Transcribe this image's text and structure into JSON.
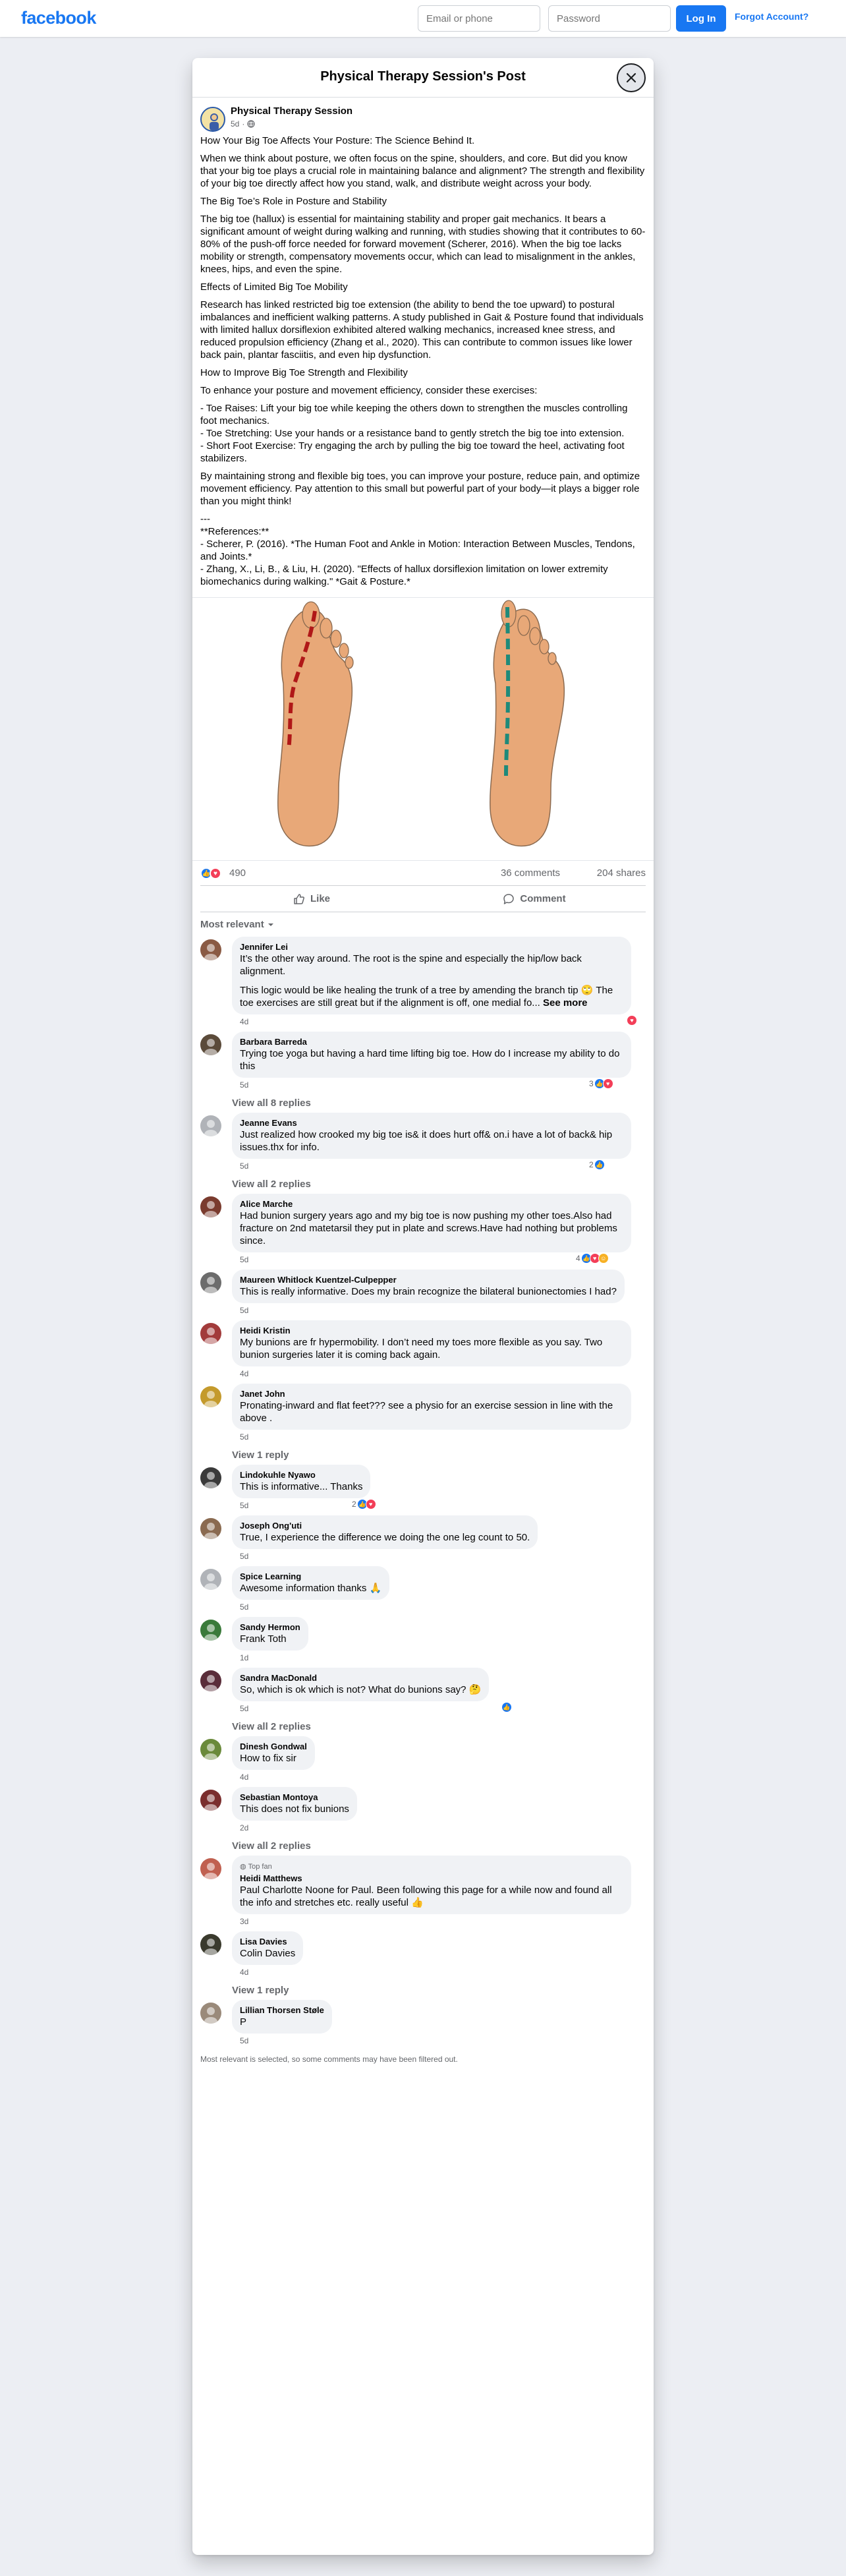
{
  "header": {
    "logo": "facebook",
    "email_placeholder": "Email or phone",
    "password_placeholder": "Password",
    "login_label": "Log In",
    "forgot_label": "Forgot Account?"
  },
  "dialog": {
    "title": "Physical Therapy Session's Post"
  },
  "post": {
    "page_name": "Physical Therapy Session",
    "time": "5d",
    "paragraphs": [
      "How Your Big Toe Affects Your Posture: The Science Behind It.",
      "When we think about posture, we often focus on the spine, shoulders, and core. But did you know that your big toe plays a crucial role in maintaining balance and alignment? The strength and flexibility of your big toe directly affect how you stand, walk, and distribute weight across your body.",
      "The Big Toe’s Role in Posture and Stability",
      "The big toe (hallux) is essential for maintaining stability and proper gait mechanics. It bears a significant amount of weight during walking and running, with studies showing that it contributes to 60-80% of the push-off force needed for forward movement (Scherer, 2016). When the big toe lacks mobility or strength, compensatory movements occur, which can lead to misalignment in the ankles, knees, hips, and even the spine.",
      "Effects of Limited Big Toe Mobility",
      "Research has linked restricted big toe extension (the ability to bend the toe upward) to postural imbalances and inefficient walking patterns. A study published in Gait & Posture found that individuals with limited hallux dorsiflexion exhibited altered walking mechanics, increased knee stress, and reduced propulsion efficiency (Zhang et al., 2020). This can contribute to common issues like lower back pain, plantar fasciitis, and even hip dysfunction.",
      "How to Improve Big Toe Strength and Flexibility",
      "To enhance your posture and movement efficiency, consider these exercises:",
      "- Toe Raises: Lift your big toe while keeping the others down to strengthen the muscles controlling foot mechanics.\n- Toe Stretching: Use your hands or a resistance band to gently stretch the big toe into extension.\n- Short Foot Exercise: Try engaging the arch by pulling the big toe toward the heel, activating foot stabilizers.",
      "By maintaining strong and flexible big toes, you can improve your posture, reduce pain, and optimize movement efficiency. Pay attention to this small but powerful part of your body—it plays a bigger role than you might think!",
      "---\n**References:**\n- Scherer, P. (2016). *The Human Foot and Ankle in Motion: Interaction Between Muscles, Tendons, and Joints.*\n- Zhang, X., Li, B., & Liu, H. (2020). \"Effects of hallux dorsiflexion limitation on lower extremity biomechanics during walking.\" *Gait & Posture.*"
    ],
    "reactions_count": "490",
    "comments_count": "36 comments",
    "shares_count": "204 shares",
    "like_label": "Like",
    "comment_label": "Comment",
    "sort_label": "Most relevant"
  },
  "comments": [
    {
      "author": "Jennifer Lei",
      "text": "It’s the other way around. The root is the spine and especially the hip/low back alignment.",
      "text2": "This logic would be like healing the trunk of a tree by amending the branch tip 🙄 The toe exercises are still great but if the alignment is off, one medial fo...",
      "see_more": "See more",
      "time": "4d",
      "reactions": "",
      "replies": ""
    },
    {
      "author": "Barbara Barreda",
      "text": "Trying toe yoga but having a hard time lifting big toe. How do I increase my ability to do this",
      "time": "5d",
      "reactions": "3",
      "replies": "View all 8 replies"
    },
    {
      "author": "Jeanne Evans",
      "text": "Just realized how crooked my big toe is& it does hurt off& on.i have a lot of back& hip issues.thx for info.",
      "time": "5d",
      "reactions": "2",
      "replies": "View all 2 replies"
    },
    {
      "author": "Alice Marche",
      "text": "Had bunion surgery years ago and my big toe is now pushing my other toes.Also had fracture on 2nd matetarsil they put in plate and screws.Have had nothing but problems since.",
      "time": "5d",
      "reactions": "4",
      "replies": ""
    },
    {
      "author": "Maureen Whitlock Kuentzel-Culpepper",
      "text": "This is really informative. Does my brain recognize the bilateral bunionectomies I had?",
      "time": "5d",
      "reactions": "",
      "replies": ""
    },
    {
      "author": "Heidi Kristin",
      "text": "My bunions are fr hypermobility. I don’t need my toes more flexible as you say. Two bunion surgeries later it is coming back again.",
      "time": "4d",
      "reactions": "",
      "replies": ""
    },
    {
      "author": "Janet John",
      "text": "Pronating-inward and flat feet??? see a physio for an exercise session in line with the above .",
      "time": "5d",
      "reactions": "",
      "replies": "View 1 reply"
    },
    {
      "author": "Lindokuhle Nyawo",
      "text": "This is informative... Thanks",
      "time": "5d",
      "reactions": "2",
      "replies": ""
    },
    {
      "author": "Joseph Ong'uti",
      "text": "True, I experience the difference we doing the one leg count to 50.",
      "time": "5d",
      "reactions": "",
      "replies": ""
    },
    {
      "author": "Spice Learning",
      "text": "Awesome information thanks 🙏",
      "time": "5d",
      "reactions": "",
      "replies": ""
    },
    {
      "author": "Sandy Hermon",
      "text": "Frank Toth",
      "time": "1d",
      "reactions": "",
      "replies": ""
    },
    {
      "author": "Sandra MacDonald",
      "text": "So, which is ok which is not? What do bunions say? 🤔",
      "time": "5d",
      "reactions": "",
      "replies": "View all 2 replies"
    },
    {
      "author": "Dinesh Gondwal",
      "text": "How to fix sir",
      "time": "4d",
      "reactions": "",
      "replies": ""
    },
    {
      "author": "Sebastian Montoya",
      "text": "This does not fix bunions",
      "time": "2d",
      "reactions": "",
      "replies": "View all 2 replies"
    },
    {
      "author": "Heidi Matthews",
      "badge": "Top fan",
      "text": "Paul Charlotte Noone for Paul. Been following this page for a while now and found all the info and stretches etc. really useful 👍",
      "time": "3d",
      "reactions": "",
      "replies": ""
    },
    {
      "author": "Lisa Davies",
      "text": "Colin Davies",
      "time": "4d",
      "reactions": "",
      "replies": "View 1 reply"
    },
    {
      "author": "Lillian Thorsen Støle",
      "text": "P",
      "time": "5d",
      "reactions": "",
      "replies": ""
    }
  ],
  "footnote": "Most relevant is selected, so some comments may have been filtered out."
}
